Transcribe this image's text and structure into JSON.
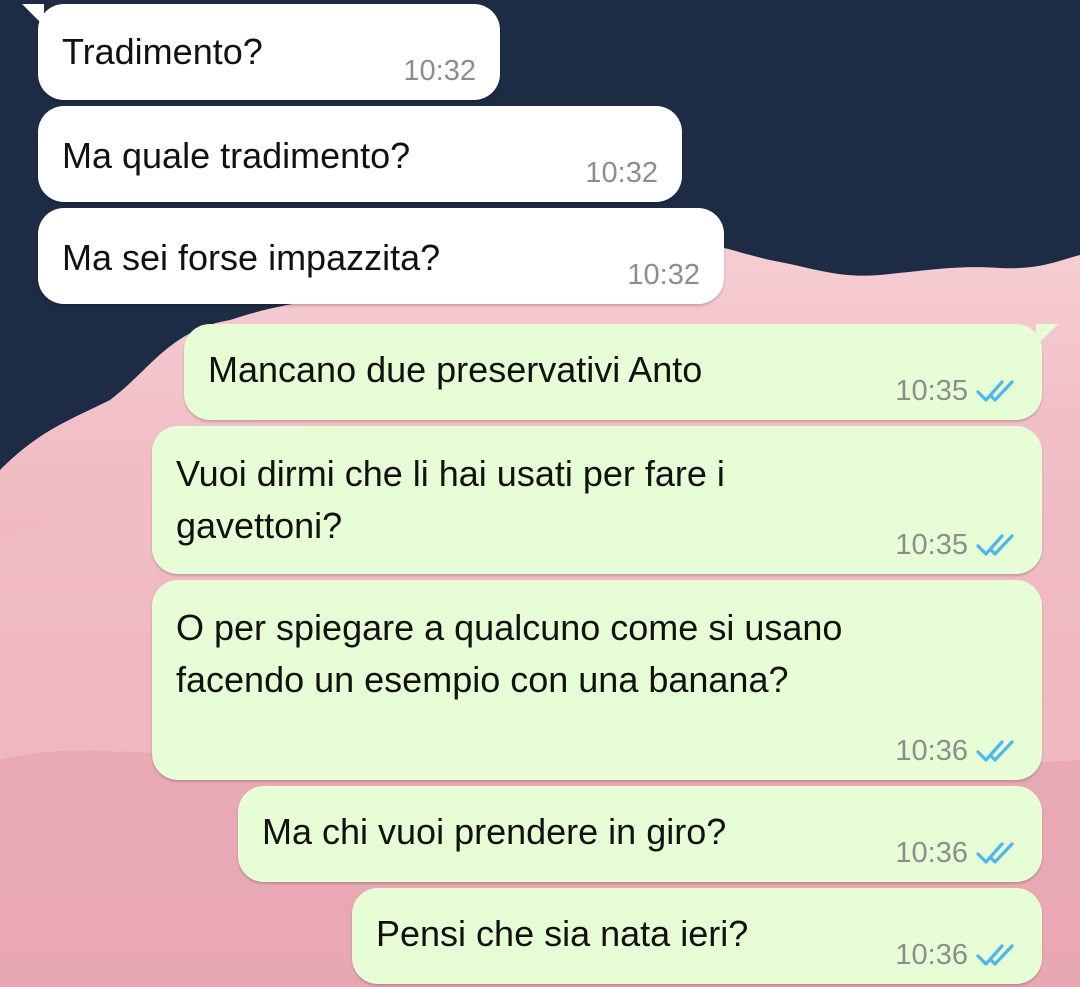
{
  "theme": {
    "background_sky": "#1d2c44",
    "cloud_color": "#f3c2c9",
    "incoming_bubble": "#ffffff",
    "outgoing_bubble": "#e7fdd6",
    "read_ticks_color": "#4fb6ec"
  },
  "messages": [
    {
      "direction": "in",
      "text": "Tradimento?",
      "time": "10:32",
      "status_icon": ""
    },
    {
      "direction": "in",
      "text": "Ma quale tradimento?",
      "time": "10:32",
      "status_icon": ""
    },
    {
      "direction": "in",
      "text": "Ma sei forse impazzita?",
      "time": "10:32",
      "status_icon": ""
    },
    {
      "direction": "out",
      "text": "Mancano due preservativi Anto",
      "time": "10:35",
      "status_icon": "double-check-read-icon"
    },
    {
      "direction": "out",
      "text": "Vuoi dirmi che li hai usati per fare i\ngavettoni?",
      "time": "10:35",
      "status_icon": "double-check-read-icon"
    },
    {
      "direction": "out",
      "text": "O per spiegare a qualcuno come si usano\nfacendo un esempio con una banana?",
      "time": "10:36",
      "status_icon": "double-check-read-icon"
    },
    {
      "direction": "out",
      "text": "Ma chi vuoi prendere in giro?",
      "time": "10:36",
      "status_icon": "double-check-read-icon"
    },
    {
      "direction": "out",
      "text": "Pensi che sia nata ieri?",
      "time": "10:36",
      "status_icon": "double-check-read-icon"
    }
  ]
}
